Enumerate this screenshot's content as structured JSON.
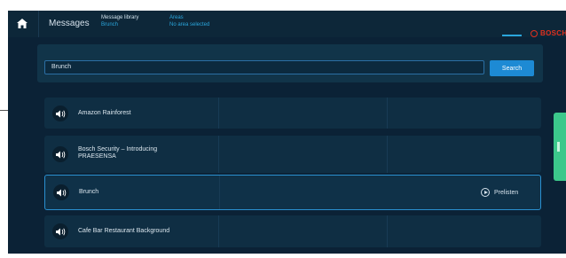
{
  "header": {
    "tab_label": "Messages",
    "breadcrumb_1": {
      "title": "Message library",
      "value": "Brunch"
    },
    "breadcrumb_2": {
      "title": "Areas",
      "value": "No area selected"
    },
    "brand": "BOSCH"
  },
  "search": {
    "value": "Brunch",
    "button_label": "Search"
  },
  "messages": [
    {
      "name": "Amazon Rainforest"
    },
    {
      "name": "Bosch Security – Introducing PRAESENSA"
    },
    {
      "name": "Brunch",
      "action": "Prelisten",
      "selected": true
    },
    {
      "name": "Cafe Bar Restaurant Background"
    }
  ],
  "colors": {
    "background": "#0b2236",
    "accent": "#1d8ad4",
    "brand_red": "#e0301e",
    "side_tab": "#3cc88b"
  },
  "icons": [
    "home-icon",
    "speaker-icon",
    "play-circle-icon"
  ]
}
